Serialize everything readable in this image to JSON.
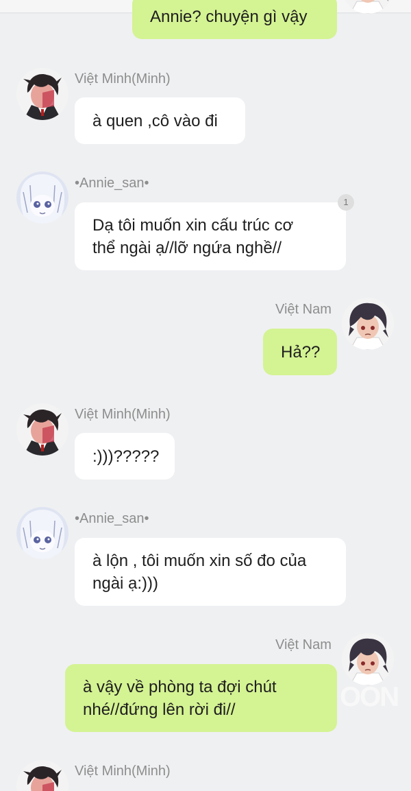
{
  "messages": [
    {
      "sender": "",
      "side": "out",
      "text": "Annie? chuyện gì vậy"
    },
    {
      "sender": "Việt Minh(Minh)",
      "side": "in",
      "avatar": "red-haired-boy-avatar",
      "text": "à quen ,cô vào đi"
    },
    {
      "sender": "•Annie_san•",
      "side": "in",
      "avatar": "white-haired-girl-avatar",
      "text": "Dạ tôi muốn xin cấu trúc cơ\nthể ngài ạ//lỡ ngứa nghề//",
      "read_count": "1"
    },
    {
      "sender": "Việt Nam",
      "side": "out",
      "avatar": "dark-haired-boy-avatar",
      "text": "Hả??"
    },
    {
      "sender": "Việt Minh(Minh)",
      "side": "in",
      "avatar": "red-haired-boy-avatar",
      "text": ":)))?????"
    },
    {
      "sender": "•Annie_san•",
      "side": "in",
      "avatar": "white-haired-girl-avatar",
      "text": "à lộn , tôi muốn xin số đo của\nngài ạ:)))"
    },
    {
      "sender": "Việt Nam",
      "side": "out",
      "avatar": "dark-haired-boy-avatar",
      "text": "à vậy về phòng ta đợi chút\nnhé//đứng lên rời đi//"
    },
    {
      "sender": "Việt Minh(Minh)",
      "side": "in",
      "avatar": "red-haired-boy-avatar",
      "text": ""
    }
  ],
  "watermark": "OON",
  "colors": {
    "background": "#eff0f2",
    "incoming_bubble": "#ffffff",
    "outgoing_bubble": "#d4f393",
    "sender_name": "#8d8d8d"
  }
}
